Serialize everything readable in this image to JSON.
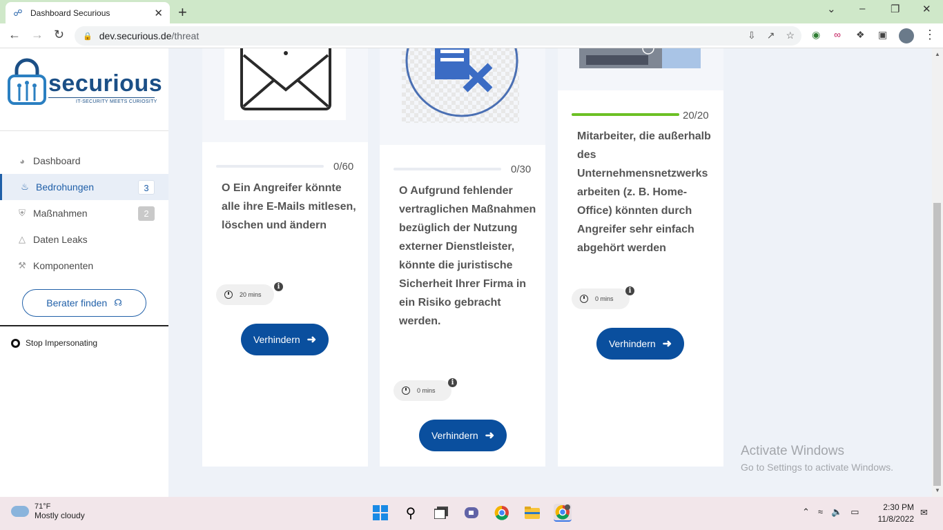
{
  "browser": {
    "tab_title": "Dashboard Securious",
    "url_host": "dev.securious.de",
    "url_path": "/threat"
  },
  "sidebar": {
    "logo_word": "securious",
    "logo_tagline": "IT-SECURITY MEETS CURIOSITY",
    "items": [
      {
        "label": "Dashboard",
        "icon": "gauge-icon"
      },
      {
        "label": "Bedrohungen",
        "icon": "alarm-icon",
        "badge": "3"
      },
      {
        "label": "Maßnahmen",
        "icon": "shield-icon",
        "badge": "2"
      },
      {
        "label": "Daten Leaks",
        "icon": "warning-icon"
      },
      {
        "label": "Komponenten",
        "icon": "wrench-icon"
      }
    ],
    "berater_label": "Berater finden",
    "stop_label": "Stop Impersonating"
  },
  "cards": [
    {
      "progress": "0/60",
      "progress_fraction": 0,
      "text": "O Ein Angreifer könnte alle ihre E-Mails mitlesen, löschen und ändern",
      "time": "20 mins",
      "button": "Verhindern"
    },
    {
      "progress": "0/30",
      "progress_fraction": 0,
      "text": "O Aufgrund fehlender vertraglichen Maßnahmen bezüglich der Nutzung externer Dienstleister, könnte die juristische Sicherheit Ihrer Firma in ein Risiko gebracht werden.",
      "time": "0 mins",
      "button": "Verhindern"
    },
    {
      "progress": "20/20",
      "progress_fraction": 1,
      "text": "Mitarbeiter, die außerhalb des Unternehmensnetzwerks arbeiten (z. B. Home-Office) könnten durch Angreifer sehr einfach abgehört werden",
      "time": "0 mins",
      "button": "Verhindern"
    }
  ],
  "watermark": {
    "line1": "Activate Windows",
    "line2": "Go to Settings to activate Windows."
  },
  "taskbar": {
    "temp": "71°F",
    "condition": "Mostly cloudy",
    "time": "2:30 PM",
    "date": "11/8/2022"
  },
  "colors": {
    "primary": "#0a4f9e",
    "progress_green": "#6cc024",
    "tab_bar": "#cfe8c9"
  }
}
